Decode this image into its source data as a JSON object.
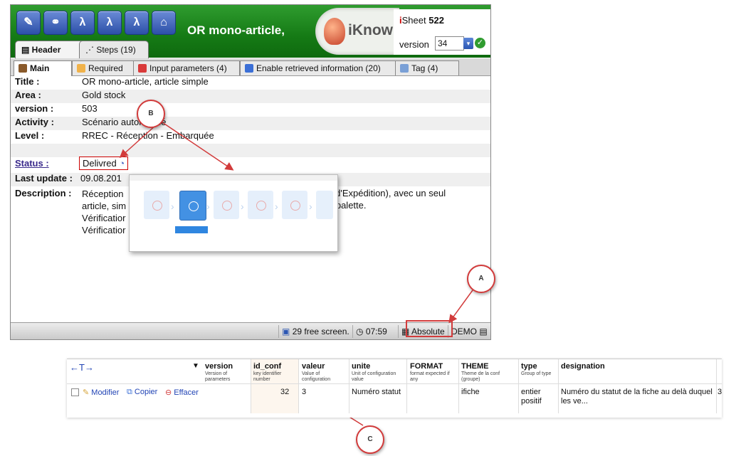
{
  "toolbar": {
    "buttons": [
      {
        "name": "edit-icon",
        "glyph": "✎"
      },
      {
        "name": "link-icon",
        "glyph": "⚭"
      },
      {
        "name": "lambda-delete-icon",
        "glyph": "λ"
      },
      {
        "name": "lambda-check-icon",
        "glyph": "λ"
      },
      {
        "name": "lambda-doc-icon",
        "glyph": "λ"
      },
      {
        "name": "home-icon",
        "glyph": "⌂"
      }
    ]
  },
  "header": {
    "title": "OR mono-article,",
    "logo_text": "iKnow",
    "sheet_prefix": "i",
    "sheet_label": "Sheet",
    "sheet_number": "522",
    "version_label": "version",
    "version_value": "34"
  },
  "tabs": [
    {
      "label": "Header"
    },
    {
      "label": "Steps (19)"
    }
  ],
  "subtabs": [
    {
      "label": "Main"
    },
    {
      "label": "Required"
    },
    {
      "label": "Input parameters (4)"
    },
    {
      "label": "Enable retrieved information (20)"
    },
    {
      "label": "Tag (4)"
    }
  ],
  "fields": {
    "title_label": "Title :",
    "title_value": "OR mono-article, article simple",
    "area_label": "Area :",
    "area_value": "Gold stock",
    "version_label": "version :",
    "version_value": "503",
    "activity_label": "Activity :",
    "activity_value": "Scénario automatisé",
    "level_label": "Level :",
    "level_value": "RREC - Réception - Embarquée",
    "status_label": "Status :",
    "status_value": "Delivred",
    "update_label": "Last update :",
    "update_value": "09.08.201",
    "desc_label": "Description :",
    "desc_lines": [
      "Réception",
      "article, sim",
      "Vérificatior",
      "Vérificatior"
    ],
    "desc_right_1": "s d'Expédition), avec un seul",
    "desc_right_2": "1 palette."
  },
  "statusbar": {
    "screens": "29 free screen.",
    "time": "07:59",
    "mode": "Absolute",
    "env": "DEMO"
  },
  "annotations": {
    "a": "A",
    "b": "B",
    "c": "C"
  },
  "dbtable": {
    "nav": "←T→",
    "columns": [
      {
        "name": "version",
        "sub": "Version of parameters"
      },
      {
        "name": "id_conf",
        "sub": "key identifier number"
      },
      {
        "name": "valeur",
        "sub": "Value of configuration"
      },
      {
        "name": "unite",
        "sub": "Unit of configuration value"
      },
      {
        "name": "FORMAT",
        "sub": "format expected if any"
      },
      {
        "name": "THEME",
        "sub": "Theme de la conf (groupe)"
      },
      {
        "name": "type",
        "sub": "Group of type"
      },
      {
        "name": "designation",
        "sub": ""
      }
    ],
    "actions": {
      "modify": "Modifier",
      "copy": "Copier",
      "delete": "Effacer"
    },
    "row": {
      "id_conf": "32",
      "valeur": "3",
      "unite": "Numéro statut",
      "theme": "ifiche",
      "type_1": "entier",
      "type_2": "positif",
      "designation_1": "Numéro du statut de la fiche au delà duquel",
      "designation_2": "les ve...",
      "extra": "3"
    }
  },
  "colors": {
    "accent": "#157a15",
    "annotation": "#d23b3b",
    "link": "#2144b5"
  }
}
